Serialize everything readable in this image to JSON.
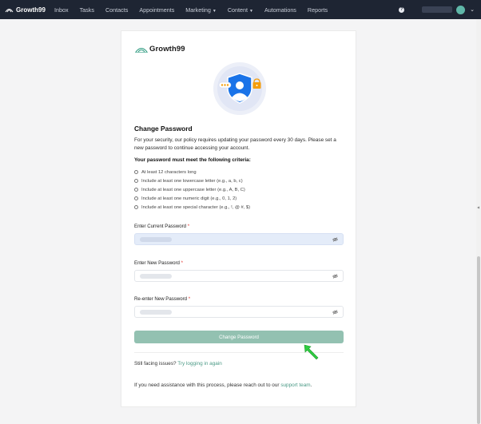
{
  "app": {
    "brand": "Growth99"
  },
  "nav": {
    "items": [
      {
        "label": "Inbox",
        "dropdown": false
      },
      {
        "label": "Tasks",
        "dropdown": false
      },
      {
        "label": "Contacts",
        "dropdown": false
      },
      {
        "label": "Appointments",
        "dropdown": false
      },
      {
        "label": "Marketing",
        "dropdown": true
      },
      {
        "label": "Content",
        "dropdown": true
      },
      {
        "label": "Automations",
        "dropdown": false
      },
      {
        "label": "Reports",
        "dropdown": false
      }
    ],
    "help_label": "?",
    "user_caret": "⌄"
  },
  "card": {
    "logo_text": "Growth99",
    "title": "Change Password",
    "intro": "For your security, our policy requires updating your password every 30 days. Please set a new password to continue accessing your account.",
    "criteria_heading": "Your password must meet the following criteria:",
    "criteria": [
      "At least 12 characters long",
      "Include at least one lowercase letter (e.g., a, b, c)",
      "Include at least one uppercase letter (e.g., A, B, C)",
      "Include at least one numeric digit (e.g., 0, 1, 2)",
      "Include at least one special character (e.g., !, @ #, $)"
    ],
    "fields": [
      {
        "label": "Enter Current Password",
        "required_mark": "*"
      },
      {
        "label": "Enter New Password",
        "required_mark": "*"
      },
      {
        "label": "Re-enter New Password",
        "required_mark": "*"
      }
    ],
    "submit_label": "Change Password",
    "still_text": "Still facing issues?",
    "still_link": "Try logging in again",
    "assist_text": "If you need assistance with this process, please reach out to our",
    "assist_link": "support team",
    "assist_end": "."
  },
  "colors": {
    "nav_bg": "#1e2533",
    "accent": "#4b9a86",
    "button_bg": "#93c1b1",
    "active_field_bg": "#e4ecf9",
    "shield_blue": "#1a73e8",
    "lock_orange": "#f59e0b",
    "cursor_green": "#2ecc40"
  },
  "icons": {
    "eye": "eye-off-icon",
    "shield": "shield-user-icon",
    "lock": "lock-icon",
    "cursor": "arrow-cursor-icon"
  }
}
